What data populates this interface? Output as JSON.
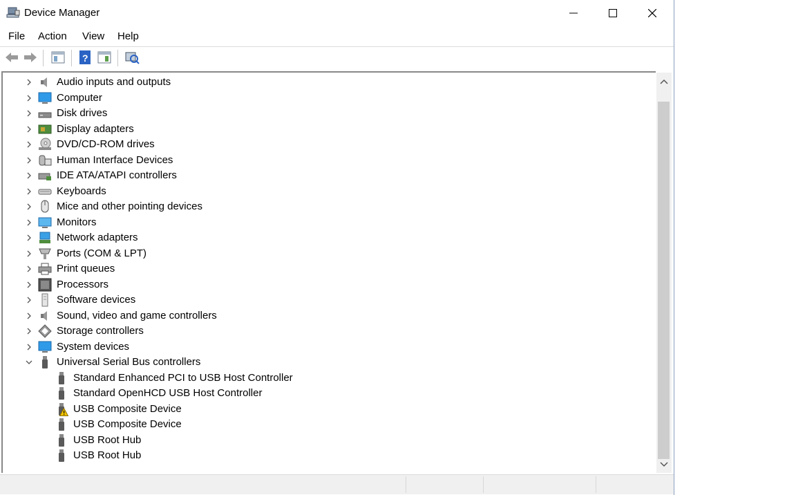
{
  "window": {
    "title": "Device Manager"
  },
  "menu": [
    "File",
    "Action",
    "View",
    "Help"
  ],
  "toolbar": [
    "back-arrow-icon",
    "forward-arrow-icon",
    "properties-icon",
    "help-icon",
    "console-icon",
    "scan-hardware-icon"
  ],
  "tree": {
    "categories": [
      {
        "label": "Audio inputs and outputs",
        "icon": "speaker-icon",
        "expanded": false
      },
      {
        "label": "Computer",
        "icon": "monitor-icon",
        "expanded": false
      },
      {
        "label": "Disk drives",
        "icon": "disk-drive-icon",
        "expanded": false
      },
      {
        "label": "Display adapters",
        "icon": "display-adapter-icon",
        "expanded": false
      },
      {
        "label": "DVD/CD-ROM drives",
        "icon": "dvd-drive-icon",
        "expanded": false
      },
      {
        "label": "Human Interface Devices",
        "icon": "hid-icon",
        "expanded": false
      },
      {
        "label": "IDE ATA/ATAPI controllers",
        "icon": "ide-controller-icon",
        "expanded": false
      },
      {
        "label": "Keyboards",
        "icon": "keyboard-icon",
        "expanded": false
      },
      {
        "label": "Mice and other pointing devices",
        "icon": "mouse-icon",
        "expanded": false
      },
      {
        "label": "Monitors",
        "icon": "monitor-icon",
        "expanded": false
      },
      {
        "label": "Network adapters",
        "icon": "network-adapter-icon",
        "expanded": false
      },
      {
        "label": "Ports (COM & LPT)",
        "icon": "port-icon",
        "expanded": false
      },
      {
        "label": "Print queues",
        "icon": "printer-icon",
        "expanded": false
      },
      {
        "label": "Processors",
        "icon": "processor-icon",
        "expanded": false
      },
      {
        "label": "Software devices",
        "icon": "software-device-icon",
        "expanded": false
      },
      {
        "label": "Sound, video and game controllers",
        "icon": "speaker-icon",
        "expanded": false
      },
      {
        "label": "Storage controllers",
        "icon": "storage-controller-icon",
        "expanded": false
      },
      {
        "label": "System devices",
        "icon": "monitor-icon",
        "expanded": false
      },
      {
        "label": "Universal Serial Bus controllers",
        "icon": "usb-icon",
        "expanded": true
      }
    ],
    "usb_children": [
      {
        "label": "Standard Enhanced PCI to USB Host Controller",
        "warning": false
      },
      {
        "label": "Standard OpenHCD USB Host Controller",
        "warning": false
      },
      {
        "label": "USB Composite Device",
        "warning": true
      },
      {
        "label": "USB Composite Device",
        "warning": false
      },
      {
        "label": "USB Root Hub",
        "warning": false
      },
      {
        "label": "USB Root Hub",
        "warning": false
      }
    ]
  },
  "colors": {
    "warning": "#f2c400",
    "accent": "#1e7fd6"
  }
}
